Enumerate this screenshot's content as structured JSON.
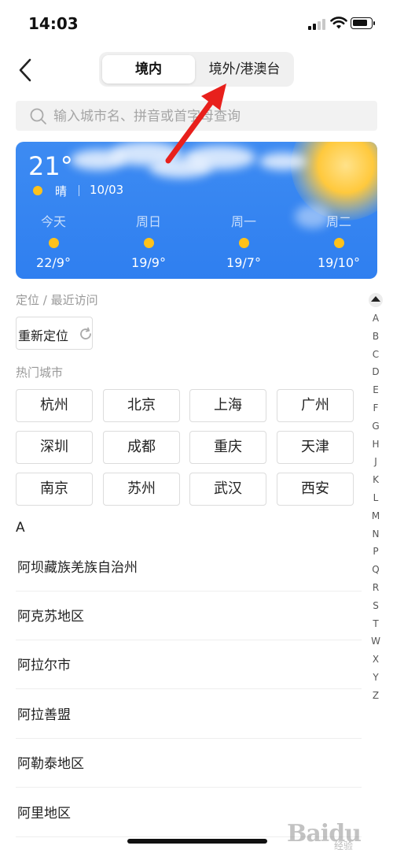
{
  "status_bar": {
    "time": "14:03"
  },
  "nav": {
    "tab_domestic": "境内",
    "tab_overseas": "境外/港澳台"
  },
  "search": {
    "placeholder": "输入城市名、拼音或首字母查询"
  },
  "weather": {
    "temperature": "21°",
    "condition": "晴",
    "date": "10/03",
    "sun_color": "#ffc21a",
    "forecast": [
      {
        "day": "今天",
        "range": "22/9°"
      },
      {
        "day": "周日",
        "range": "19/9°"
      },
      {
        "day": "周一",
        "range": "19/7°"
      },
      {
        "day": "周二",
        "range": "19/10°"
      }
    ]
  },
  "location": {
    "section_title": "定位 / 最近访问",
    "relocate_label": "重新定位"
  },
  "hot_cities": {
    "section_title": "热门城市",
    "cities": [
      "杭州",
      "北京",
      "上海",
      "广州",
      "深圳",
      "成都",
      "重庆",
      "天津",
      "南京",
      "苏州",
      "武汉",
      "西安"
    ]
  },
  "city_list": {
    "letter": "A",
    "items": [
      "阿坝藏族羌族自治州",
      "阿克苏地区",
      "阿拉尔市",
      "阿拉善盟",
      "阿勒泰地区",
      "阿里地区"
    ]
  },
  "index_bar": {
    "letters": [
      "A",
      "B",
      "C",
      "D",
      "E",
      "F",
      "G",
      "H",
      "J",
      "K",
      "L",
      "M",
      "N",
      "P",
      "Q",
      "R",
      "S",
      "T",
      "W",
      "X",
      "Y",
      "Z"
    ]
  },
  "watermark": {
    "text": "Baidu",
    "sub": "经验"
  },
  "colors": {
    "accent_arrow": "#e8201c",
    "card_blue": "#2f7ff0"
  }
}
